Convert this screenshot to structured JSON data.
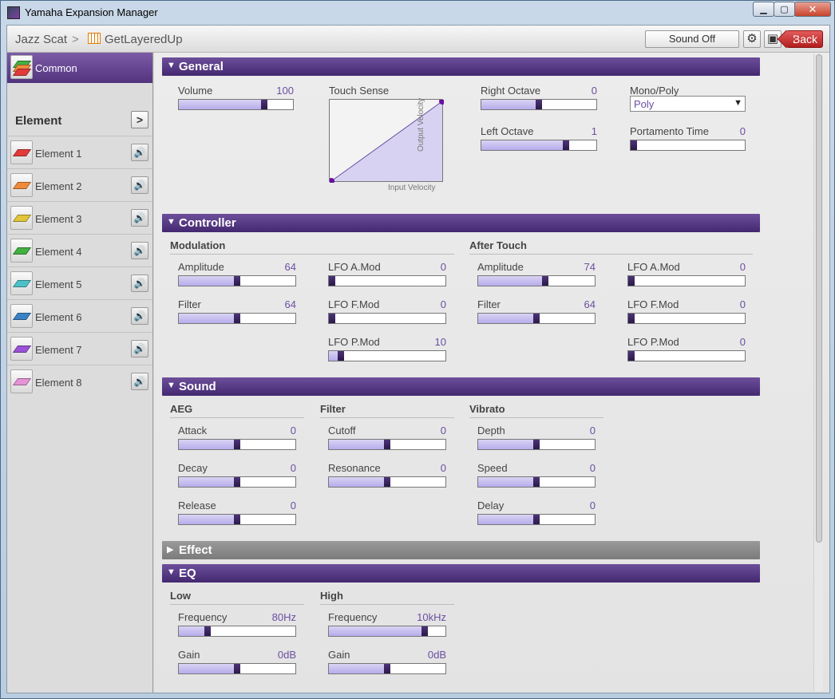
{
  "window": {
    "title": "Yamaha Expansion Manager",
    "minimize": "▁",
    "maximize": "▢",
    "close": "✕"
  },
  "header": {
    "crumb_1": "Jazz Scat",
    "crumb_sep": ">",
    "crumb_2": "GetLayeredUp",
    "sound_off": "Sound Off",
    "back": "Back",
    "gear_icon": "⚙",
    "save_icon": "▣"
  },
  "sidebar": {
    "common": "Common",
    "element_heading": "Element",
    "arrow": ">",
    "speaker_icon": "🔊",
    "elements": [
      {
        "label": "Element 1",
        "color": "#e23b3b"
      },
      {
        "label": "Element 2",
        "color": "#f08a3a"
      },
      {
        "label": "Element 3",
        "color": "#e2c53a"
      },
      {
        "label": "Element 4",
        "color": "#43b042"
      },
      {
        "label": "Element 5",
        "color": "#4cc2c8"
      },
      {
        "label": "Element 6",
        "color": "#3b82c4"
      },
      {
        "label": "Element 7",
        "color": "#9a52d6"
      },
      {
        "label": "Element 8",
        "color": "#e592d6"
      }
    ]
  },
  "sections": {
    "general": "General",
    "controller": "Controller",
    "sound": "Sound",
    "effect": "Effect",
    "eq": "EQ",
    "expanded_tri": "▼",
    "collapsed_tri": "▶"
  },
  "general": {
    "volume": {
      "label": "Volume",
      "value": "100",
      "level": 0.76
    },
    "touch_sense": {
      "label": "Touch Sense",
      "x_label": "Input Velocity",
      "y_label": "Output Velocity"
    },
    "right_octave": {
      "label": "Right Octave",
      "value": "0",
      "level": 0.5
    },
    "left_octave": {
      "label": "Left Octave",
      "value": "1",
      "level": 0.75
    },
    "mono_poly": {
      "label": "Mono/Poly",
      "value": "Poly",
      "arrow": "▼"
    },
    "portamento": {
      "label": "Portamento Time",
      "value": "0",
      "level": 0.0
    }
  },
  "controller": {
    "modulation": "Modulation",
    "after_touch": "After Touch",
    "mod": [
      {
        "label": "Amplitude",
        "value": "64",
        "level": 0.5
      },
      {
        "label": "Filter",
        "value": "64",
        "level": 0.5
      },
      {
        "label": "LFO A.Mod",
        "value": "0",
        "level": 0.0
      },
      {
        "label": "LFO F.Mod",
        "value": "0",
        "level": 0.0
      },
      {
        "label": "LFO P.Mod",
        "value": "10",
        "level": 0.08
      }
    ],
    "at": [
      {
        "label": "Amplitude",
        "value": "74",
        "level": 0.58
      },
      {
        "label": "Filter",
        "value": "64",
        "level": 0.5
      },
      {
        "label": "LFO A.Mod",
        "value": "0",
        "level": 0.0
      },
      {
        "label": "LFO F.Mod",
        "value": "0",
        "level": 0.0
      },
      {
        "label": "LFO P.Mod",
        "value": "0",
        "level": 0.0
      }
    ]
  },
  "sound": {
    "aeg": "AEG",
    "filter": "Filter",
    "vibrato": "Vibrato",
    "attack": {
      "label": "Attack",
      "value": "0",
      "level": 0.5
    },
    "decay": {
      "label": "Decay",
      "value": "0",
      "level": 0.5
    },
    "release": {
      "label": "Release",
      "value": "0",
      "level": 0.5
    },
    "cutoff": {
      "label": "Cutoff",
      "value": "0",
      "level": 0.5
    },
    "resonance": {
      "label": "Resonance",
      "value": "0",
      "level": 0.5
    },
    "depth": {
      "label": "Depth",
      "value": "0",
      "level": 0.5
    },
    "speed": {
      "label": "Speed",
      "value": "0",
      "level": 0.5
    },
    "delay": {
      "label": "Delay",
      "value": "0",
      "level": 0.5
    }
  },
  "eq": {
    "low": "Low",
    "high": "High",
    "low_freq": {
      "label": "Frequency",
      "value": "80Hz",
      "level": 0.23
    },
    "low_gain": {
      "label": "Gain",
      "value": "0dB",
      "level": 0.5
    },
    "high_freq": {
      "label": "Frequency",
      "value": "10kHz",
      "level": 0.84
    },
    "high_gain": {
      "label": "Gain",
      "value": "0dB",
      "level": 0.5
    }
  },
  "colors": {
    "accent": "#52337e",
    "value_text": "#6a4fa1"
  }
}
